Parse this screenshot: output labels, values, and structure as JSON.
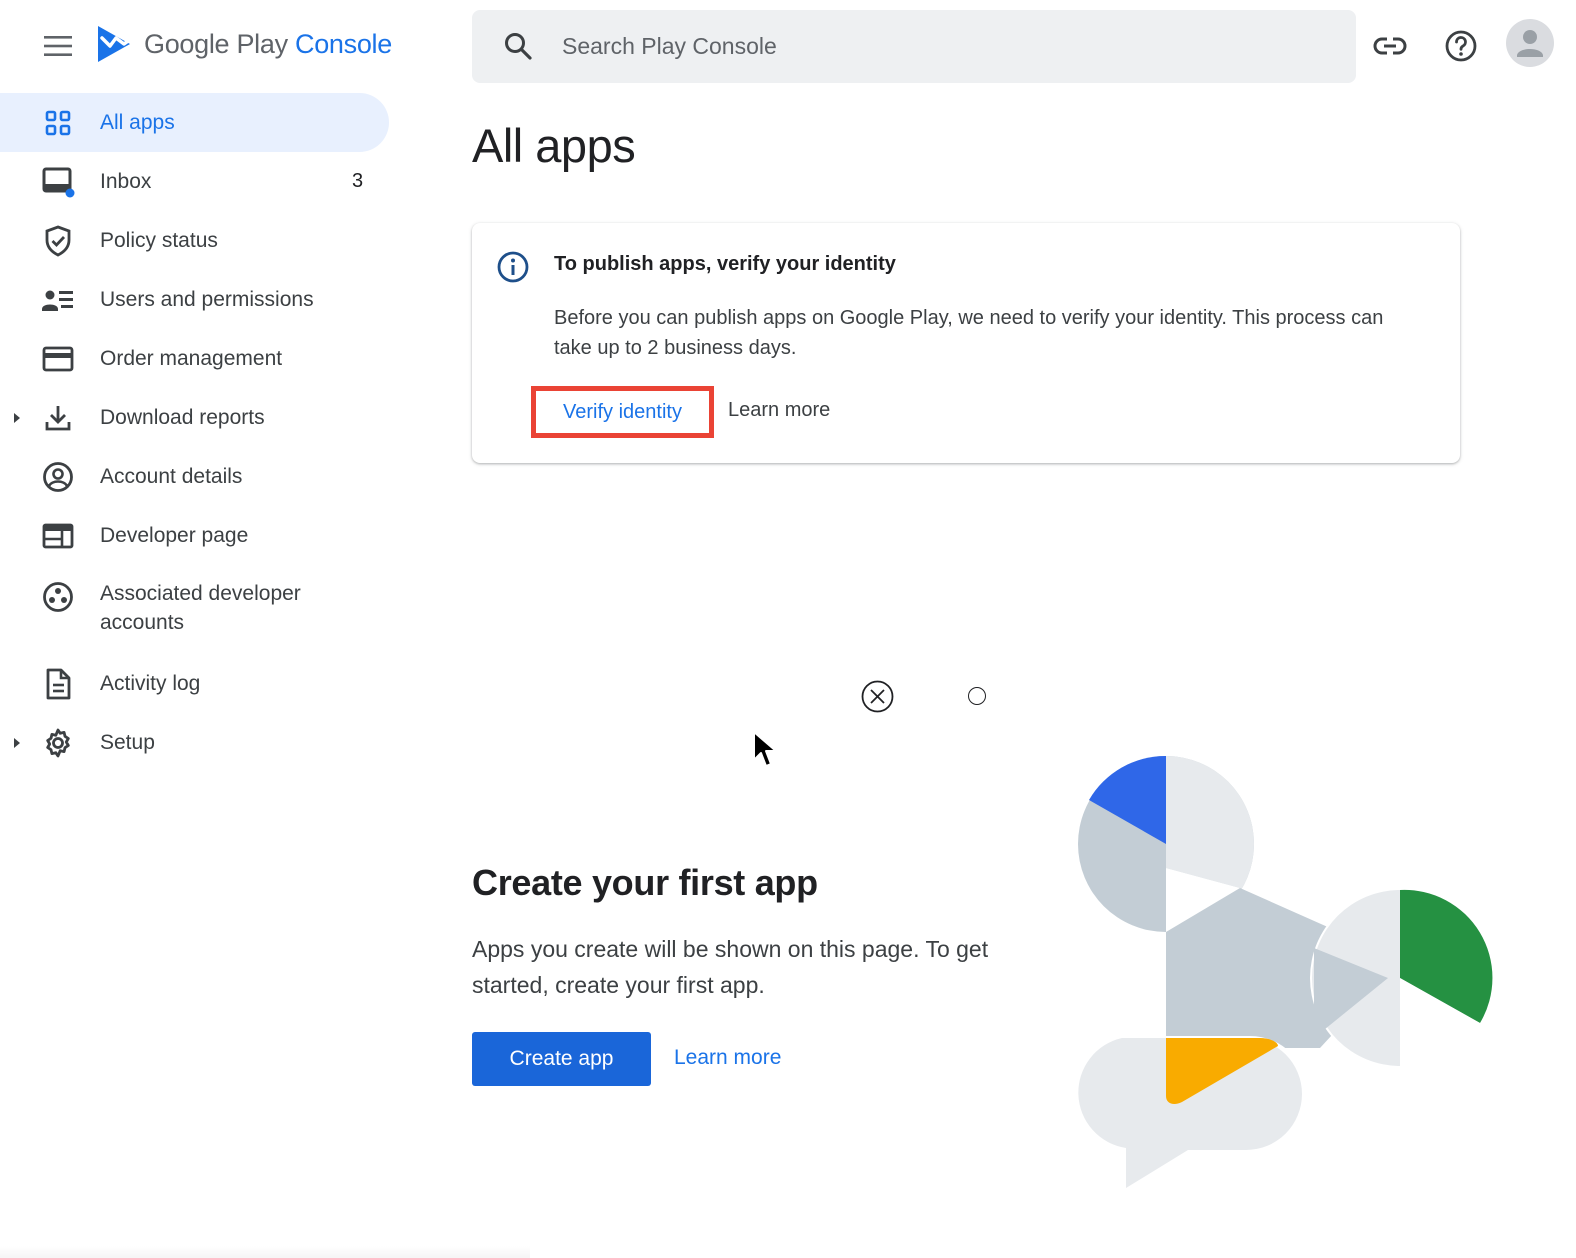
{
  "header": {
    "logo_text_main": "Google Play ",
    "logo_text_accent": "Console",
    "search_placeholder": "Search Play Console",
    "icons": [
      "menu-icon",
      "link-icon",
      "help-icon",
      "account-avatar"
    ]
  },
  "sidebar": {
    "items": [
      {
        "label": "All apps",
        "icon": "grid-icon",
        "active": true
      },
      {
        "label": "Inbox",
        "icon": "inbox-icon",
        "count": "3"
      },
      {
        "label": "Policy status",
        "icon": "shield-icon"
      },
      {
        "label": "Users and permissions",
        "icon": "users-icon"
      },
      {
        "label": "Order management",
        "icon": "card-icon"
      },
      {
        "label": "Download reports",
        "icon": "download-icon",
        "expandable": true
      },
      {
        "label": "Account details",
        "icon": "account-icon"
      },
      {
        "label": "Developer page",
        "icon": "web-icon"
      },
      {
        "label": "Associated developer accounts",
        "icon": "workspaces-icon"
      },
      {
        "label": "Activity log",
        "icon": "document-icon"
      },
      {
        "label": "Setup",
        "icon": "gear-icon",
        "expandable": true
      }
    ]
  },
  "main": {
    "title": "All apps",
    "notice": {
      "title": "To publish apps, verify your identity",
      "body": "Before you can publish apps on Google Play, we need to verify your identity. This process can take up to 2 business days.",
      "verify_label": "Verify identity",
      "learn_more_label": "Learn more"
    },
    "empty_state": {
      "heading": "Create your first app",
      "description": "Apps you create will be shown on this page. To get started, create your first app.",
      "create_label": "Create app",
      "learn_more_label": "Learn more"
    }
  },
  "colors": {
    "accent": "#1a73e8",
    "highlight_border": "#ea4335",
    "active_bg": "#e8f0fe",
    "primary_button": "#1a66d9"
  }
}
